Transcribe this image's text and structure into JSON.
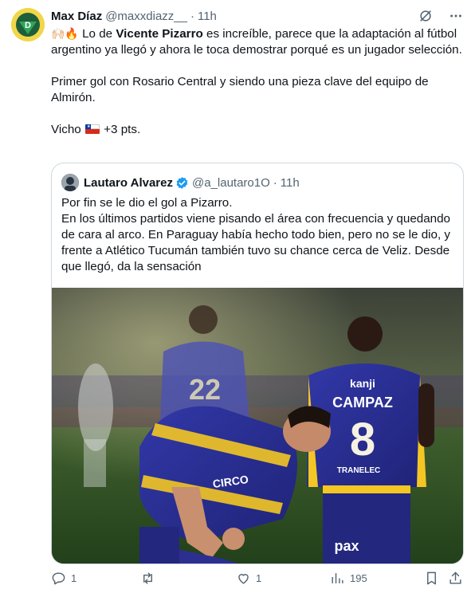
{
  "tweet": {
    "author_name": "Max Díaz",
    "author_handle": "@maxxdiazz__",
    "separator": "·",
    "time": "11h",
    "intro_emojis": "🙌🏻🔥",
    "line1_pre": " Lo de ",
    "line1_bold": "Vicente Pizarro",
    "line1_post": " es increíble, parece que la adaptación al fútbol argentino ya llegó y ahora le toca demostrar porqué es un jugador selección.",
    "para2": "Primer gol con Rosario Central y siendo una pieza clave del equipo de Almirón.",
    "para3_pre": "Vicho ",
    "para3_post": " +3 pts."
  },
  "quote": {
    "author_name": "Lautaro Alvarez",
    "author_handle": "@a_lautaro1O",
    "separator": "·",
    "time": "11h",
    "lines": [
      "Por fin se le dio el gol a Pizarro.",
      "En los últimos partidos viene pisando el área con frecuencia y quedando de cara al arco. En Paraguay había hecho todo bien, pero no se le dio, y frente a Atlético Tucumán también tuvo su chance cerca de Veliz. Desde que llegó, da la sensación"
    ],
    "photo": {
      "jersey_sponsor_left": "CIRCO",
      "jersey_sponsor_right": "kanji",
      "player_name_back": "CAMPAZ",
      "player_number": "8",
      "bg_player_number": "22",
      "shorts_sponsor": "pax",
      "jersey_brand": "TRANELEC"
    }
  },
  "actions": {
    "reply_count": "1",
    "retweet_count": "",
    "like_count": "1",
    "views_count": "195"
  },
  "colors": {
    "text": "#0f1419",
    "muted": "#536471",
    "border": "#cfd9de",
    "verified": "#1d9bf0",
    "jersey_blue": "#2c2f8f",
    "jersey_yellow": "#f3c623"
  }
}
